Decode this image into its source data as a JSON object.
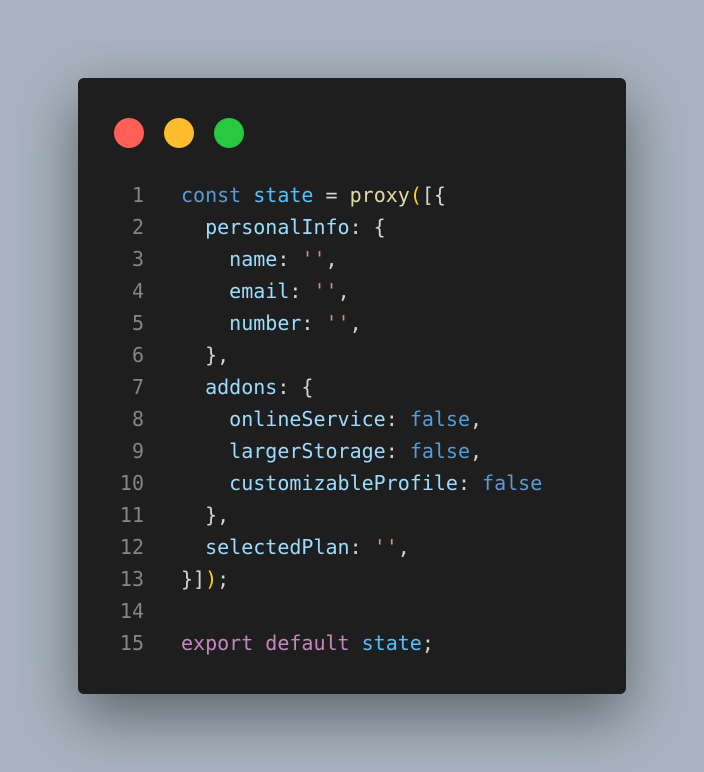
{
  "window": {
    "controls": [
      {
        "name": "close",
        "color": "#ff5f57"
      },
      {
        "name": "minimize",
        "color": "#febc2e"
      },
      {
        "name": "maximize",
        "color": "#28c840"
      }
    ]
  },
  "editor": {
    "language": "javascript",
    "lines": [
      {
        "number": "1",
        "tokens": [
          {
            "t": "const",
            "k": "keyword"
          },
          {
            "t": " ",
            "k": "space"
          },
          {
            "t": "state",
            "k": "variable"
          },
          {
            "t": " = ",
            "k": "punct"
          },
          {
            "t": "proxy",
            "k": "function"
          },
          {
            "t": "(",
            "k": "bracket"
          },
          {
            "t": "[{",
            "k": "punct"
          }
        ]
      },
      {
        "number": "2",
        "tokens": [
          {
            "t": "  ",
            "k": "space"
          },
          {
            "t": "personalInfo",
            "k": "property"
          },
          {
            "t": ": {",
            "k": "punct"
          }
        ]
      },
      {
        "number": "3",
        "tokens": [
          {
            "t": "    ",
            "k": "space"
          },
          {
            "t": "name",
            "k": "property"
          },
          {
            "t": ": ",
            "k": "punct"
          },
          {
            "t": "''",
            "k": "string"
          },
          {
            "t": ",",
            "k": "punct"
          }
        ]
      },
      {
        "number": "4",
        "tokens": [
          {
            "t": "    ",
            "k": "space"
          },
          {
            "t": "email",
            "k": "property"
          },
          {
            "t": ": ",
            "k": "punct"
          },
          {
            "t": "''",
            "k": "string"
          },
          {
            "t": ",",
            "k": "punct"
          }
        ]
      },
      {
        "number": "5",
        "tokens": [
          {
            "t": "    ",
            "k": "space"
          },
          {
            "t": "number",
            "k": "property"
          },
          {
            "t": ": ",
            "k": "punct"
          },
          {
            "t": "''",
            "k": "string"
          },
          {
            "t": ",",
            "k": "punct"
          }
        ]
      },
      {
        "number": "6",
        "tokens": [
          {
            "t": "  ",
            "k": "space"
          },
          {
            "t": "},",
            "k": "punct"
          }
        ]
      },
      {
        "number": "7",
        "tokens": [
          {
            "t": "  ",
            "k": "space"
          },
          {
            "t": "addons",
            "k": "property"
          },
          {
            "t": ": {",
            "k": "punct"
          }
        ]
      },
      {
        "number": "8",
        "tokens": [
          {
            "t": "    ",
            "k": "space"
          },
          {
            "t": "onlineService",
            "k": "property"
          },
          {
            "t": ": ",
            "k": "punct"
          },
          {
            "t": "false",
            "k": "boolean"
          },
          {
            "t": ",",
            "k": "punct"
          }
        ]
      },
      {
        "number": "9",
        "tokens": [
          {
            "t": "    ",
            "k": "space"
          },
          {
            "t": "largerStorage",
            "k": "property"
          },
          {
            "t": ": ",
            "k": "punct"
          },
          {
            "t": "false",
            "k": "boolean"
          },
          {
            "t": ",",
            "k": "punct"
          }
        ]
      },
      {
        "number": "10",
        "tokens": [
          {
            "t": "    ",
            "k": "space"
          },
          {
            "t": "customizableProfile",
            "k": "property"
          },
          {
            "t": ": ",
            "k": "punct"
          },
          {
            "t": "false",
            "k": "boolean"
          }
        ]
      },
      {
        "number": "11",
        "tokens": [
          {
            "t": "  ",
            "k": "space"
          },
          {
            "t": "},",
            "k": "punct"
          }
        ]
      },
      {
        "number": "12",
        "tokens": [
          {
            "t": "  ",
            "k": "space"
          },
          {
            "t": "selectedPlan",
            "k": "property"
          },
          {
            "t": ": ",
            "k": "punct"
          },
          {
            "t": "''",
            "k": "string"
          },
          {
            "t": ",",
            "k": "punct"
          }
        ]
      },
      {
        "number": "13",
        "tokens": [
          {
            "t": "}]",
            "k": "punct"
          },
          {
            "t": ")",
            "k": "bracket"
          },
          {
            "t": ";",
            "k": "punct"
          }
        ]
      },
      {
        "number": "14",
        "tokens": []
      },
      {
        "number": "15",
        "tokens": [
          {
            "t": "export",
            "k": "control"
          },
          {
            "t": " ",
            "k": "space"
          },
          {
            "t": "default",
            "k": "control"
          },
          {
            "t": " ",
            "k": "space"
          },
          {
            "t": "state",
            "k": "variable"
          },
          {
            "t": ";",
            "k": "punct"
          }
        ]
      }
    ]
  }
}
